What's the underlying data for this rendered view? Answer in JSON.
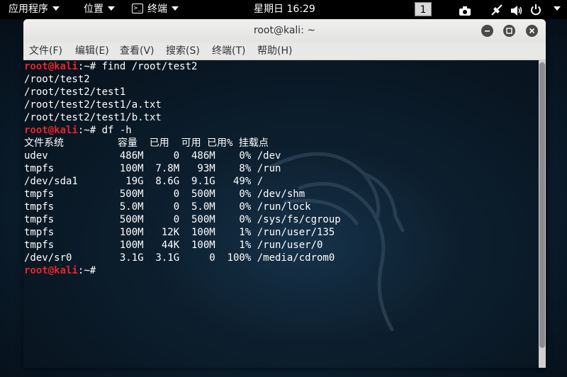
{
  "topbar": {
    "applications_label": "应用程序",
    "places_label": "位置",
    "terminal_label": "终端",
    "terminal_icon_text": ">_",
    "clock": "星期日 16:29",
    "workspace_number": "1"
  },
  "window": {
    "title": "root@kali: ~"
  },
  "menubar": {
    "items": [
      {
        "label": "文件(F)"
      },
      {
        "label": "编辑(E)"
      },
      {
        "label": "查看(V)"
      },
      {
        "label": "搜索(S)"
      },
      {
        "label": "终端(T)"
      },
      {
        "label": "帮助(H)"
      }
    ]
  },
  "terminal": {
    "prompt_user": "root@kali",
    "prompt_path": ":~# ",
    "lines": [
      {
        "prompt": true,
        "text": "find /root/test2"
      },
      {
        "prompt": false,
        "text": "/root/test2"
      },
      {
        "prompt": false,
        "text": "/root/test2/test1"
      },
      {
        "prompt": false,
        "text": "/root/test2/test1/a.txt"
      },
      {
        "prompt": false,
        "text": "/root/test2/test1/b.txt"
      },
      {
        "prompt": true,
        "text": "df -h"
      },
      {
        "prompt": false,
        "text": "文件系统         容量  已用  可用 已用% 挂载点"
      },
      {
        "prompt": false,
        "text": "udev            486M     0  486M    0% /dev"
      },
      {
        "prompt": false,
        "text": "tmpfs           100M  7.8M   93M    8% /run"
      },
      {
        "prompt": false,
        "text": "/dev/sda1        19G  8.6G  9.1G   49% /"
      },
      {
        "prompt": false,
        "text": "tmpfs           500M     0  500M    0% /dev/shm"
      },
      {
        "prompt": false,
        "text": "tmpfs           5.0M     0  5.0M    0% /run/lock"
      },
      {
        "prompt": false,
        "text": "tmpfs           500M     0  500M    0% /sys/fs/cgroup"
      },
      {
        "prompt": false,
        "text": "tmpfs           100M   12K  100M    1% /run/user/135"
      },
      {
        "prompt": false,
        "text": "tmpfs           100M   44K  100M    1% /run/user/0"
      },
      {
        "prompt": false,
        "text": "/dev/sr0        3.1G  3.1G     0  100% /media/cdrom0"
      },
      {
        "prompt": true,
        "text": ""
      }
    ]
  },
  "colors": {
    "prompt_user": "#e8262b",
    "terminal_text": "#ffffff",
    "topbar_bg": "#000000"
  },
  "icons": [
    "terminal-icon",
    "camera-icon",
    "network-icon",
    "volume-icon",
    "power-icon",
    "minimize-icon",
    "maximize-icon",
    "close-icon"
  ]
}
